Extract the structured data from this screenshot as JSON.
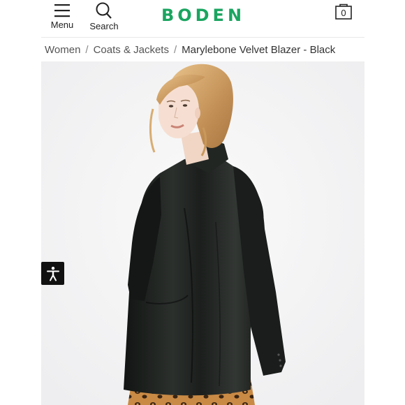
{
  "header": {
    "menu_label": "Menu",
    "search_label": "Search",
    "logo_text": "BODEN",
    "bag_count": "0",
    "brand_color": "#1aa560"
  },
  "breadcrumb": {
    "items": [
      "Women",
      "Coats & Jackets"
    ],
    "separator": "/",
    "current": "Marylebone Velvet Blazer - Black"
  },
  "icons": {
    "menu": "hamburger-icon",
    "search": "search-icon",
    "bag": "shopping-bag-icon",
    "accessibility": "accessibility-icon"
  }
}
